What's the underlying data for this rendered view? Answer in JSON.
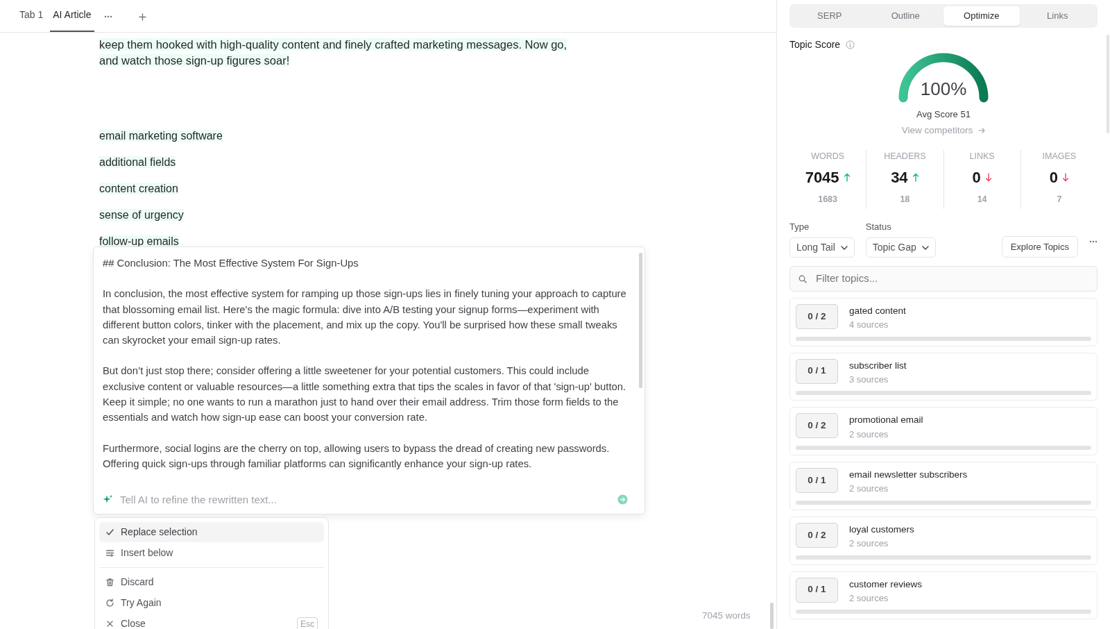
{
  "tabs": [
    {
      "label": "Tab 1",
      "selected": false
    },
    {
      "label": "AI Article",
      "selected": true
    }
  ],
  "editor": {
    "paragraphs": [
      "keep them hooked with high-quality content and finely crafted marketing messages. Now go, and watch those sign-up figures soar!"
    ],
    "keywords": [
      "email marketing software",
      "additional fields",
      "content creation",
      "sense of urgency",
      "follow-up emails"
    ],
    "word_count": "7045 words"
  },
  "ai_box": {
    "heading": "## Conclusion: The Most Effective System For Sign-Ups",
    "paragraphs": [
      "In conclusion, the most effective system for ramping up those sign-ups lies in finely tuning your approach to capture that blossoming email list. Here's the magic formula: dive into A/B testing your signup forms—experiment with different button colors, tinker with the placement, and mix up the copy. You'll be surprised how these small tweaks can skyrocket your email sign-up rates.",
      "But don’t just stop there; consider offering a little sweetener for your potential customers. This could include exclusive content or valuable resources—a little something extra that tips the scales in favor of that 'sign-up' button. Keep it simple; no one wants to run a marathon just to hand over their email address. Trim those form fields to the essentials and watch how sign-up ease can boost your conversion rate.",
      "Furthermore, social logins are the cherry on top, allowing users to bypass the dread of creating new passwords. Offering quick sign-ups through familiar platforms can significantly enhance your sign-up rates."
    ],
    "placeholder": "Tell AI to refine the rewritten text..."
  },
  "menu": [
    {
      "kind": "check",
      "label": "Replace selection",
      "selected": true
    },
    {
      "kind": "insert",
      "label": "Insert below",
      "selected": false
    },
    {
      "kind": "trash",
      "label": "Discard",
      "selected": false
    },
    {
      "kind": "retry",
      "label": "Try Again",
      "selected": false
    },
    {
      "kind": "close",
      "label": "Close",
      "selected": false,
      "shortcut": "Esc"
    }
  ],
  "panel": {
    "tabs": [
      {
        "label": "SERP",
        "selected": false
      },
      {
        "label": "Outline",
        "selected": false
      },
      {
        "label": "Optimize",
        "selected": true
      },
      {
        "label": "Links",
        "selected": false
      }
    ],
    "topic_score": {
      "title": "Topic Score",
      "value": "100%",
      "avg": "Avg Score 51",
      "link": "View competitors"
    },
    "stats": [
      {
        "label": "WORDS",
        "value": "7045",
        "above_target": true,
        "target": "1683"
      },
      {
        "label": "HEADERS",
        "value": "34",
        "above_target": true,
        "target": "18"
      },
      {
        "label": "LINKS",
        "value": "0",
        "above_target": false,
        "target": "14"
      },
      {
        "label": "IMAGES",
        "value": "0",
        "above_target": false,
        "target": "7"
      }
    ],
    "filters": [
      {
        "label": "Type",
        "value": "Long Tail"
      },
      {
        "label": "Status",
        "value": "Topic Gap"
      }
    ],
    "explore_button": "Explore Topics",
    "search": {
      "placeholder": "Filter topics..."
    },
    "topics": [
      {
        "count": "0 / 2",
        "name": "gated content",
        "sources": "4 sources",
        "level": 0
      },
      {
        "count": "0 / 1",
        "name": "subscriber list",
        "sources": "3 sources",
        "level": 0
      },
      {
        "count": "0 / 2",
        "name": "promotional email",
        "sources": "2 sources",
        "level": 0
      },
      {
        "count": "0 / 1",
        "name": "email newsletter subscribers",
        "sources": "2 sources",
        "level": 0
      },
      {
        "count": "0 / 2",
        "name": "loyal customers",
        "sources": "2 sources",
        "level": 0
      },
      {
        "count": "0 / 1",
        "name": "customer reviews",
        "sources": "2 sources",
        "level": 0
      }
    ]
  }
}
